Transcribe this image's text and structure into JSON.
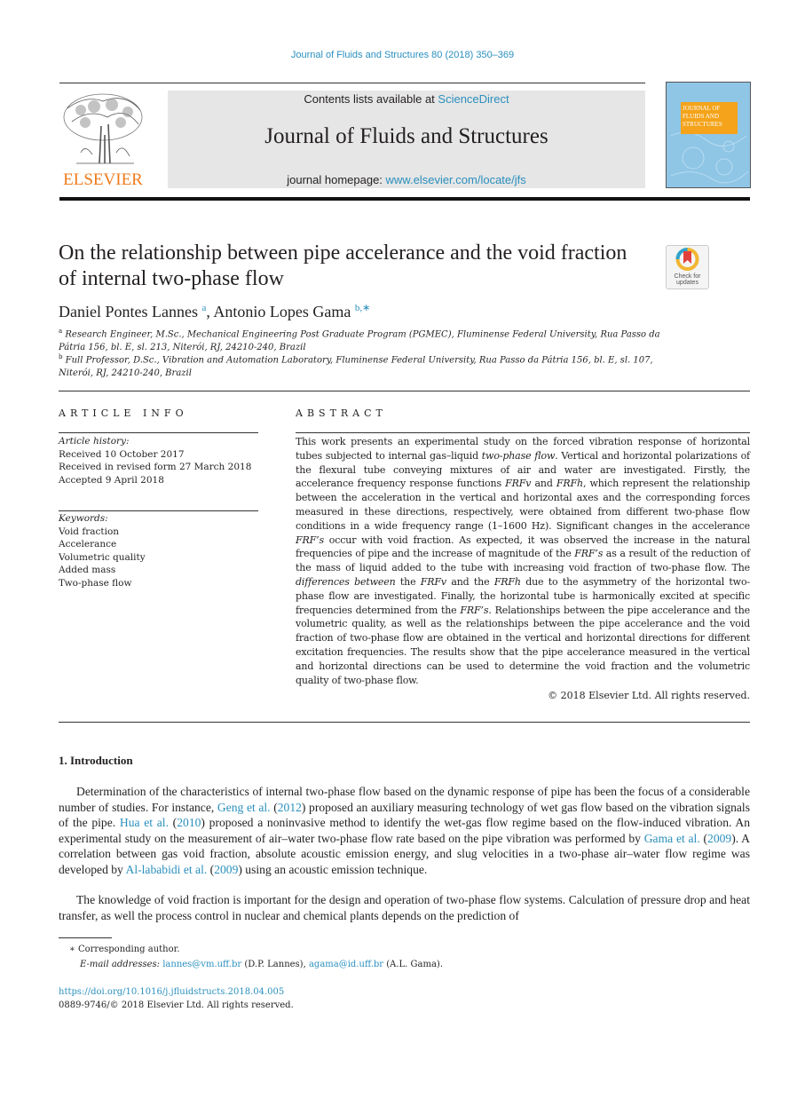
{
  "journal_ref": "Journal of Fluids and Structures 80 (2018) 350–369",
  "header": {
    "publisher_logo_text": "ELSEVIER",
    "contents_prefix": "Contents lists available at ",
    "contents_link": "ScienceDirect",
    "journal_title": "Journal of Fluids and Structures",
    "homepage_prefix": "journal homepage: ",
    "homepage_link": "www.elsevier.com/locate/jfs",
    "cover_label": "JOURNAL OF FLUIDS AND STRUCTURES",
    "colors": {
      "link": "#2a8fbd",
      "publisher": "#ef7a1a",
      "cover_bg": "#8fc6e6",
      "cover_label": "#f4a31a",
      "banner": "#e6e6e6"
    }
  },
  "article": {
    "title": "On the relationship between pipe accelerance and the void fraction of internal two-phase flow",
    "check_updates": "Check for updates",
    "authors": [
      {
        "name": "Daniel Pontes Lannes",
        "sup": "a"
      },
      {
        "name": "Antonio Lopes Gama",
        "sup": "b,∗"
      }
    ],
    "author_separator": ", ",
    "affiliations": [
      {
        "sup": "a",
        "text": "Research Engineer, M.Sc., Mechanical Engineering Post Graduate Program (PGMEC), Fluminense Federal University, Rua Passo da Pátria 156, bl. E, sl. 213, Niterói, RJ, 24210-240, Brazil"
      },
      {
        "sup": "b",
        "text": "Full Professor, D.Sc., Vibration and Automation Laboratory, Fluminense Federal University, Rua Passo da Pátria 156, bl. E, sl. 107, Niterói, RJ, 24210-240, Brazil"
      }
    ]
  },
  "article_info": {
    "heading": "ARTICLE INFO",
    "history_label": "Article history:",
    "history": [
      "Received 10 October 2017",
      "Received in revised form 27 March 2018",
      "Accepted 9 April 2018"
    ],
    "keywords_label": "Keywords:",
    "keywords": [
      "Void fraction",
      "Accelerance",
      "Volumetric quality",
      "Added mass",
      "Two-phase flow"
    ]
  },
  "abstract": {
    "heading": "ABSTRACT",
    "parts": [
      "This work presents an experimental study on the forced vibration response of horizontal tubes subjected to internal gas–liquid ",
      "two-phase flow",
      ". Vertical and horizontal polarizations of the flexural tube conveying mixtures of air and water are investigated. Firstly, the accelerance frequency response functions ",
      "FRFv",
      " and ",
      "FRFh",
      ", which represent the relationship between the acceleration in the vertical and horizontal axes and the corresponding forces measured in these directions, respectively, were obtained from different two-phase flow conditions in a wide frequency range (1–1600 Hz). Significant changes in the accelerance ",
      "FRF’s",
      " occur with void fraction. As expected, it was observed the increase in the natural frequencies of pipe and the increase of magnitude of the ",
      "FRF’s",
      " as a result of the reduction of the mass of liquid added to the tube with increasing void fraction of two-phase flow. The ",
      "differences between",
      " the ",
      "FRFv",
      " and the ",
      "FRFh",
      " due to the asymmetry of the horizontal two-phase flow are investigated. Finally, the horizontal tube is harmonically excited at specific frequencies determined from the ",
      "FRF’s",
      ". Relationships between the pipe accelerance and the volumetric quality, as well as the relationships between the pipe accelerance and the void fraction of two-phase flow are obtained in the vertical and horizontal directions for different excitation frequencies. The results show that the pipe accelerance measured in the vertical and horizontal directions can be used to determine the void fraction and the volumetric quality of two-phase flow."
    ],
    "copyright": "© 2018 Elsevier Ltd. All rights reserved."
  },
  "introduction": {
    "heading": "1.  Introduction",
    "p1": [
      "Determination of the characteristics of internal two-phase flow based on the dynamic response of pipe has been the focus of a considerable number of studies. For instance, ",
      "Geng et al.",
      " (",
      "2012",
      ") proposed an auxiliary measuring technology of wet gas flow based on the vibration signals of the pipe. ",
      "Hua et al.",
      " (",
      "2010",
      ") proposed a noninvasive method to identify the wet-gas flow regime based on the flow-induced vibration. An experimental study on the measurement of air–water two-phase flow rate based on the pipe vibration was performed by ",
      "Gama et al.",
      " (",
      "2009",
      "). A correlation between gas void fraction, absolute acoustic emission energy, and slug velocities in a two-phase air–water flow regime was developed by ",
      "Al-lababidi et al.",
      " (",
      "2009",
      ") using an acoustic emission technique."
    ],
    "p2": "The knowledge of void fraction is important for the design and operation of two-phase flow systems. Calculation of pressure drop and heat transfer, as well the process control in nuclear and chemical plants depends on the prediction of"
  },
  "footnotes": {
    "star": "∗",
    "corresponding": "Corresponding author.",
    "email_label": "E-mail addresses:",
    "email1": "lannes@vm.uff.br",
    "email1_owner": " (D.P. Lannes), ",
    "email2": "agama@id.uff.br",
    "email2_owner": " (A.L. Gama).",
    "doi": "https://doi.org/10.1016/j.jfluidstructs.2018.04.005",
    "issn": "0889-9746/© 2018 Elsevier Ltd.  All rights reserved."
  }
}
